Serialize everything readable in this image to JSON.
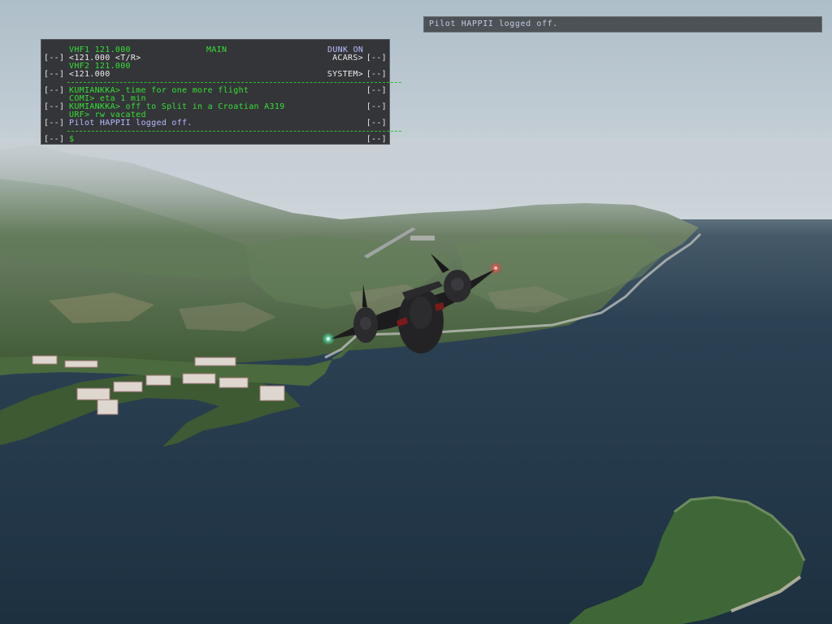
{
  "notification": {
    "text": "Pilot HAPPII logged off."
  },
  "radio_panel": {
    "lsk_label": "[--]",
    "header": {
      "vhf1": "VHF1 121.000",
      "page": "MAIN",
      "dunk": "DUNK ON"
    },
    "row1": {
      "freq": "<121.000 <T/R>",
      "right": "ACARS>"
    },
    "vhf2_label": "VHF2 121.000",
    "row2": {
      "freq": "<121.000",
      "right": "SYSTEM>"
    },
    "messages": [
      "KUMIANKKA> time for one more flight",
      "COMI> eta 1 min",
      "KUMIANKKA> off to Split in a Croatian A319",
      "URF> rw vacated",
      "Pilot HAPPII logged off."
    ],
    "input": "$"
  },
  "colors": {
    "radio_text": "#35e035",
    "active_text": "#ececec",
    "system_text": "#b7bcff",
    "sea": "#1f3344",
    "sky": "#cdd5db"
  },
  "scene": {
    "subject": "black-aircraft-icon",
    "lights": [
      "green-nav-light-icon",
      "red-nav-light-icon"
    ]
  }
}
